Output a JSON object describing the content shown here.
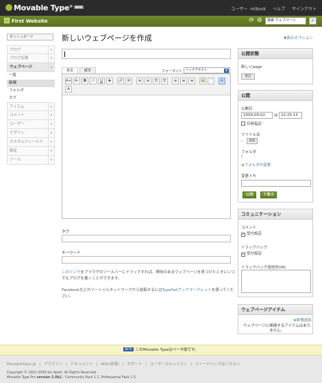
{
  "app": {
    "brand": "Movable Type",
    "brand_suffix": "®",
    "beta_badge": "BETA",
    "user_label": "ユーザー",
    "username": "mtbook",
    "help": "ヘルプ",
    "signout": "サインアウト"
  },
  "site": {
    "name": "First Website",
    "search_value": "検索 ウェブページ"
  },
  "sidebar": {
    "dashboard": "ダッシュボード",
    "items": [
      {
        "label": "ブログ"
      },
      {
        "label": "ブログ記事"
      },
      {
        "label": "ウェブページ"
      },
      {
        "label": "アイテム"
      },
      {
        "label": "コメント"
      },
      {
        "label": "ユーザー"
      },
      {
        "label": "デザイン"
      },
      {
        "label": "カスタムフィールド"
      },
      {
        "label": "設定"
      },
      {
        "label": "ツール"
      }
    ],
    "subitems": [
      "一覧",
      "新規",
      "フォルダ",
      "タグ"
    ]
  },
  "main": {
    "title": "新しいウェブページを作成",
    "display_options": "▼表示オプション",
    "tab_body": "本文",
    "tab_more": "続き",
    "format_label": "フォーマット",
    "format_value": "リッチテキスト",
    "tags_label": "タグ",
    "keywords_label": "キーワード",
    "bookmarklet_link": "このリンク",
    "bookmarklet_text": "をブラウザのツールバーにドラッグすれば、興味のあるウェブページを見つけたときにいつでもブログを書くことができます。",
    "social_text": "Facebookなどのソーシャルネットワークから投稿するには",
    "social_link": "TypePadブックマークレット",
    "social_tail": "を使ってください。"
  },
  "toolbar": {
    "buttons": [
      "A+",
      "A-",
      "B",
      "I",
      "U",
      "S",
      "🔗",
      "✉",
      "≡",
      "≡",
      "☰",
      "☰",
      "≡",
      "≡",
      "≡",
      "🖼",
      "📄",
      "A",
      "A"
    ]
  },
  "publish_status": {
    "title": "公開状態",
    "value": "新しいpage",
    "preview_button": "確認"
  },
  "publish": {
    "title": "公開",
    "date_label": "公開日",
    "date_value": "2009-09-02",
    "at": "@",
    "time_value": "22:25:15",
    "auto_label": "日時指定",
    "filename_label": "ファイル名",
    "filename_button": "編集",
    "folder_label": "フォルダ",
    "folder_value": "/",
    "change_folder": "フォルダの変更",
    "memo_label": "変更メモ",
    "publish_button": "公開",
    "draft_button": "下書き"
  },
  "communication": {
    "title": "コミュニケーション",
    "comment_label": "コメント",
    "comment_accept": "受付設定",
    "trackback_label": "トラックバック",
    "trackback_accept": "受付設定",
    "trackback_url_label": "トラックバック送信先URL"
  },
  "page_items": {
    "title": "ウェブページアイテム",
    "new_item": "新規追加",
    "empty_text": "ウェブページに関連するアイテムはありません。"
  },
  "beta_notice": {
    "badge": "BETA",
    "text": "このMovable Typeはベータ版です。"
  },
  "footer": {
    "links": [
      "MovableType.jp",
      "|",
      "プラグイン",
      "|",
      "ドキュメント",
      "|",
      "Wiki(英語)",
      "|",
      "サポート",
      "|",
      "ユーザーコミュニティ",
      "|",
      "フィードバックはこちらへ"
    ],
    "copyright": "Copyright © 2001-2009 Six Apart. All Rights Reserved.",
    "version_prefix": "Movable Type Pro",
    "version": "version 5.0b1",
    "version_suffix": " - Community Pack 1.1, Professional Pack 1.5"
  }
}
